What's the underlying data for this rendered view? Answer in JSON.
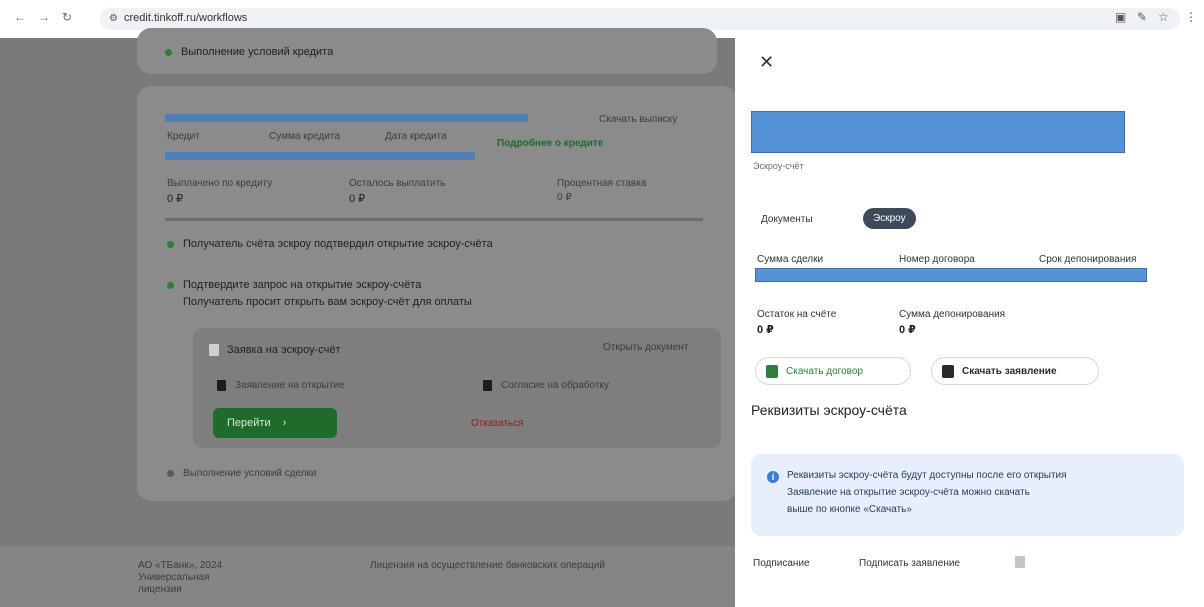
{
  "browser": {
    "url": "credit.tinkoff.ru/workflows",
    "nav": {
      "back": "←",
      "forward": "→",
      "reload": "↻"
    }
  },
  "page": {
    "rows": [
      {
        "label": "Выполнение условий кредита"
      }
    ],
    "card": {
      "top_right_link": "Скачать выписку",
      "cols": [
        "Кредит",
        "Сумма кредита",
        "Дата кредита"
      ],
      "details_link": "Подробнее о кредите",
      "metrics": [
        {
          "label": "Выплачено по кредиту",
          "value": "0 ₽"
        },
        {
          "label": "Осталось выплатить",
          "value": "0 ₽"
        },
        {
          "label": "Процентная ставка",
          "value": "0 ₽"
        }
      ],
      "step1": "Получатель счёта эскроу подтвердил открытие эскроу-счёта",
      "step2": "Подтвердите запрос на открытие эскроу-счёта",
      "step2_sub": "Получатель просит открыть вам эскроу-счёт для оплаты",
      "sub_card": {
        "title": "Заявка на эскроу-счёт",
        "right_link": "Открыть документ",
        "doc1": "Заявление на открытие",
        "doc2": "Согласие на обработку",
        "go_button": "Перейти",
        "decline": "Отказаться"
      },
      "step3": "Выполнение условий сделки"
    },
    "footer_left": [
      "АО «ТБанк», 2024",
      "Универсальная",
      "лицензия"
    ],
    "footer_right": "Лицензия на осуществление банковских операций"
  },
  "panel": {
    "close": "✕",
    "caption": "Эскроу-счёт",
    "tabs": [
      {
        "label": "Документы",
        "active": false
      },
      {
        "label": "Эскроу",
        "active": true
      }
    ],
    "row_labels": [
      "Сумма сделки",
      "Номер договора",
      "Срок депонирования"
    ],
    "balances": [
      {
        "label": "Остаток на счёте",
        "value": "0 ₽"
      },
      {
        "label": "Сумма депонирования",
        "value": "0 ₽"
      }
    ],
    "buttons": [
      {
        "label": "Скачать договор",
        "icon": "document-icon",
        "color": "#2e7d3a"
      },
      {
        "label": "Скачать заявление",
        "icon": "document-icon",
        "color": "#2b2b2b"
      }
    ],
    "section_title": "Реквизиты эскроу-счёта",
    "info_lines": [
      "Реквизиты эскроу-счёта будут доступны после его открытия",
      "Заявление на открытие эскроу-счёта можно скачать",
      "выше по кнопке «Скачать»"
    ],
    "footer_left": "Подписание",
    "footer_right": "Подписать заявление"
  },
  "colors": {
    "overlay": "#7a7a7a",
    "card": "#8b8b8b",
    "accent_green": "#1f6b2c",
    "redaction_blue": "#5593d6"
  }
}
